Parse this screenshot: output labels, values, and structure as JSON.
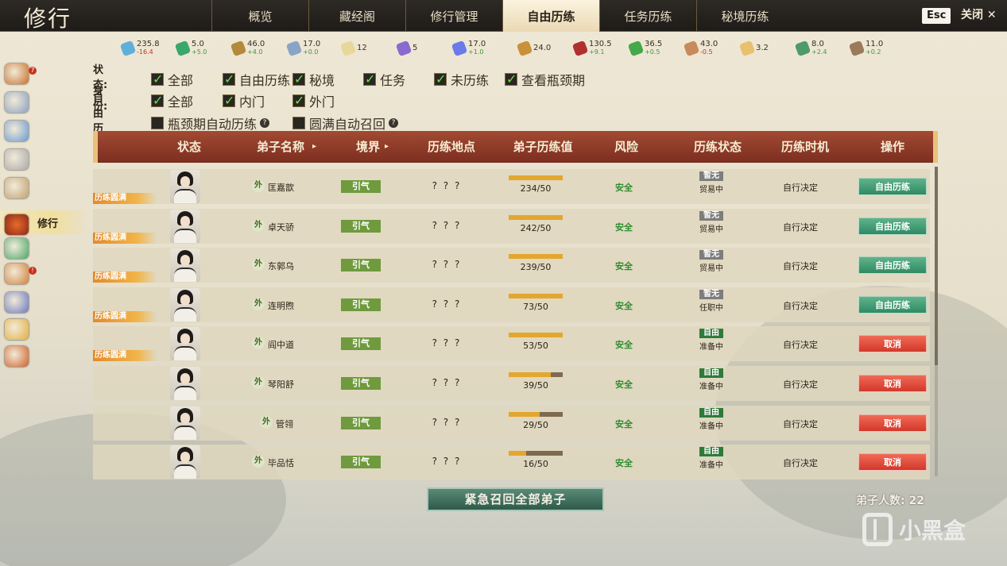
{
  "window": {
    "title": "修行",
    "esc": "Esc",
    "close_label": "关闭"
  },
  "tabs": [
    {
      "label": "概览"
    },
    {
      "label": "藏经阁"
    },
    {
      "label": "修行管理"
    },
    {
      "label": "自由历练",
      "active": true
    },
    {
      "label": "任务历练"
    },
    {
      "label": "秘境历练"
    }
  ],
  "resources": [
    {
      "value": "235.8",
      "delta": "-16.4",
      "color": "#5fb0d8",
      "icon": "spirit-stone-icon"
    },
    {
      "value": "5.0",
      "delta": "+5.0",
      "color": "#3aa86a",
      "icon": "herb-leaf-icon"
    },
    {
      "value": "46.0",
      "delta": "+4.0",
      "color": "#b38a3a",
      "icon": "wood-icon"
    },
    {
      "value": "17.0",
      "delta": "+0.0",
      "color": "#8aa4c8",
      "icon": "iron-ingot-icon"
    },
    {
      "value": "12",
      "delta": "",
      "color": "#e8d79a",
      "icon": "people-icon"
    },
    {
      "value": "5",
      "delta": "",
      "color": "#8a6ad0",
      "icon": "orb-icon"
    },
    {
      "value": "17.0",
      "delta": "+1.0",
      "color": "#6a7ae8",
      "icon": "starlight-icon"
    },
    {
      "value": "24.0",
      "delta": "",
      "color": "#c9913a",
      "icon": "scroll-icon"
    },
    {
      "value": "130.5",
      "delta": "+9.1",
      "color": "#b03030",
      "icon": "red-feather-icon"
    },
    {
      "value": "36.5",
      "delta": "+0.5",
      "color": "#45a84a",
      "icon": "jade-icon"
    },
    {
      "value": "43.0",
      "delta": "-0.5",
      "color": "#c88a5a",
      "icon": "meat-icon"
    },
    {
      "value": "3.2",
      "delta": "",
      "color": "#e8c070",
      "icon": "gourd-icon"
    },
    {
      "value": "8.0",
      "delta": "+2.4",
      "color": "#4e9a6a",
      "icon": "cloth-icon"
    },
    {
      "value": "11.0",
      "delta": "+0.2",
      "color": "#9a7a5a",
      "icon": "hide-icon"
    }
  ],
  "sidebar": {
    "active_label": "修行",
    "items": [
      {
        "icon": "book-icon",
        "badge": "7"
      },
      {
        "icon": "mountain-icon"
      },
      {
        "icon": "gear-disc-icon"
      },
      {
        "icon": "scroll-icon"
      },
      {
        "icon": "brush-icon"
      },
      {
        "icon": "cauldron-icon"
      },
      {
        "icon": "jade-chest-icon"
      },
      {
        "icon": "treasure-box-icon",
        "badge": "!"
      },
      {
        "icon": "warriors-icon"
      },
      {
        "icon": "gold-ingot-icon"
      },
      {
        "icon": "fire-orb-icon"
      }
    ]
  },
  "filters": {
    "status": {
      "label": "状态:",
      "options": [
        "全部",
        "自由历练",
        "秘境",
        "任务",
        "未历练",
        "查看瓶颈期"
      ]
    },
    "identity": {
      "label": "身份:",
      "options": [
        "全部",
        "内门",
        "外门"
      ]
    },
    "auto": {
      "label": "自由历练:",
      "options": [
        "瓶颈期自动历练",
        "圆满自动召回"
      ]
    }
  },
  "table": {
    "headers": [
      "状态",
      "弟子名称",
      "境界",
      "历练地点",
      "弟子历练值",
      "风险",
      "历练状态",
      "历练时机",
      "操作"
    ],
    "rows": [
      {
        "full": "历练圆满",
        "sect": "外",
        "name": "匡嘉歆",
        "realm": "引气",
        "location": "? ? ?",
        "value": "234/50",
        "progress": 1.0,
        "risk": "安全",
        "state_tag": "暂无",
        "state": "贸易中",
        "timing": "自行决定",
        "action": "自由历练",
        "action_type": "go"
      },
      {
        "full": "历练圆满",
        "sect": "外",
        "name": "卓天骄",
        "realm": "引气",
        "location": "? ? ?",
        "value": "242/50",
        "progress": 1.0,
        "risk": "安全",
        "state_tag": "暂无",
        "state": "贸易中",
        "timing": "自行决定",
        "action": "自由历练",
        "action_type": "go"
      },
      {
        "full": "历练圆满",
        "sect": "外",
        "name": "东郭乌",
        "realm": "引气",
        "location": "? ? ?",
        "value": "239/50",
        "progress": 1.0,
        "risk": "安全",
        "state_tag": "暂无",
        "state": "贸易中",
        "timing": "自行决定",
        "action": "自由历练",
        "action_type": "go"
      },
      {
        "full": "历练圆满",
        "sect": "外",
        "name": "连明煦",
        "realm": "引气",
        "location": "? ? ?",
        "value": "73/50",
        "progress": 1.0,
        "risk": "安全",
        "state_tag": "暂无",
        "state": "任职中",
        "timing": "自行决定",
        "action": "自由历练",
        "action_type": "go"
      },
      {
        "full": "历练圆满",
        "sect": "外",
        "name": "阎中道",
        "realm": "引气",
        "location": "? ? ?",
        "value": "53/50",
        "progress": 1.0,
        "risk": "安全",
        "state_tag": "自由",
        "state": "准备中",
        "timing": "自行决定",
        "action": "取消",
        "action_type": "cancel"
      },
      {
        "full": "",
        "sect": "外",
        "name": "琴阳舒",
        "realm": "引气",
        "location": "? ? ?",
        "value": "39/50",
        "progress": 0.78,
        "risk": "安全",
        "state_tag": "自由",
        "state": "准备中",
        "timing": "自行决定",
        "action": "取消",
        "action_type": "cancel"
      },
      {
        "full": "",
        "sect": "外",
        "name": "管翎",
        "realm": "引气",
        "location": "? ? ?",
        "value": "29/50",
        "progress": 0.58,
        "risk": "安全",
        "state_tag": "自由",
        "state": "准备中",
        "timing": "自行决定",
        "action": "取消",
        "action_type": "cancel"
      },
      {
        "full": "",
        "sect": "外",
        "name": "毕品恬",
        "realm": "引气",
        "location": "? ? ?",
        "value": "16/50",
        "progress": 0.32,
        "risk": "安全",
        "state_tag": "自由",
        "state": "准备中",
        "timing": "自行决定",
        "action": "取消",
        "action_type": "cancel"
      }
    ]
  },
  "footer": {
    "recall_label": "紧急召回全部弟子",
    "count_label": "弟子人数: 22",
    "watermark": "小黑盒"
  },
  "colors": {
    "tag_none": "#7d7d7d",
    "tag_free": "#2f7a3a",
    "header": "#8c3a28"
  }
}
